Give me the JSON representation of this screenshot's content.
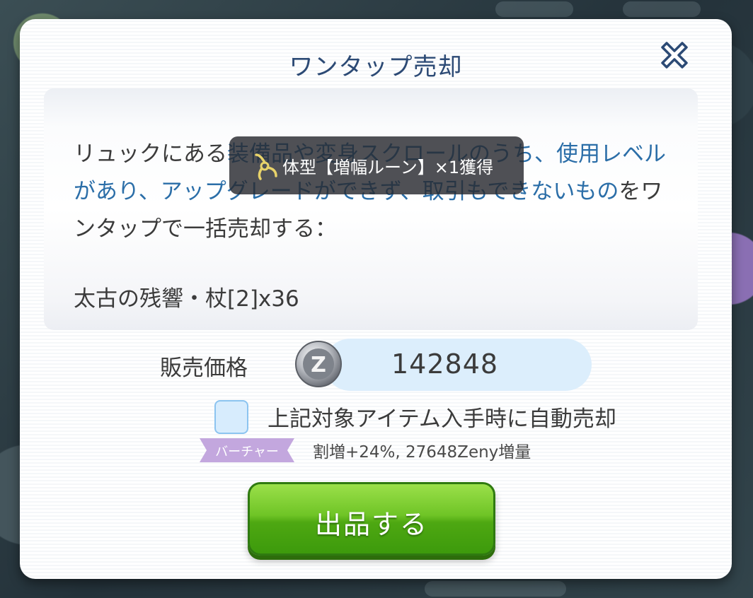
{
  "dialog": {
    "title": "ワンタップ売却",
    "close_icon": "close-x-icon"
  },
  "description": {
    "part1": "リュックにある",
    "part2": "装備品や変身スクロールのうち、使用レベルがあり、アップグレードができず、取引もできないもの",
    "part3": "をワンタップで一括売却する："
  },
  "item_line": "太古の残響・杖[2]x36",
  "toast": {
    "text": "体型【増幅ルーン】×1獲得",
    "icon": "rune-icon"
  },
  "price": {
    "label": "販売価格",
    "value": "142848",
    "currency_icon": "zeny-coin-icon"
  },
  "auto_sell": {
    "label": "上記対象アイテム入手時に自動売却",
    "checked": false
  },
  "bonus": {
    "badge": "バーチャー",
    "text": "割増+24%, 27648Zeny増量"
  },
  "sell_button": {
    "label": "出品する"
  },
  "colors": {
    "title": "#2c4a75",
    "highlight": "#2b6ea8",
    "button_green": "#6fc426",
    "badge_purple": "#c3a7de",
    "price_field": "#dceefc"
  }
}
